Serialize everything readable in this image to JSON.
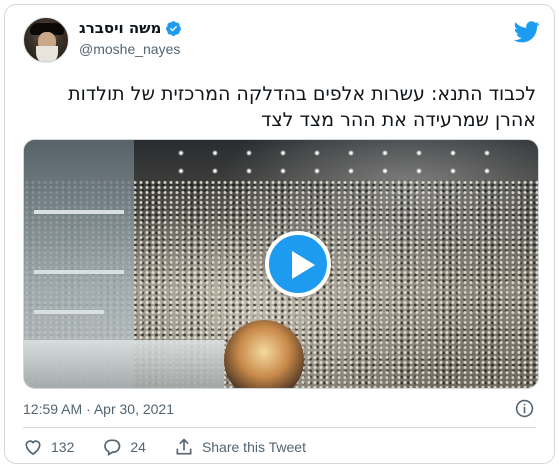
{
  "author": {
    "display_name": "משה ויסברג",
    "handle": "@moshe_nayes",
    "verified_icon": "verified-badge-icon",
    "avatar_icon": "profile-photo"
  },
  "brand": {
    "logo_icon": "twitter-bird-icon",
    "accent_color": "#1d9bf0"
  },
  "tweet": {
    "text": "לכבוד התנא: עשרות אלפים בהדלקה המרכזית של תולדות אהרן שמרעידה את ההר מצד לצד",
    "media": {
      "type": "video",
      "play_icon": "play-icon"
    },
    "timestamp": "12:59 AM · Apr 30, 2021",
    "info_icon": "info-icon"
  },
  "actions": {
    "like_count": "132",
    "reply_count": "24",
    "share_label": "Share this Tweet"
  }
}
